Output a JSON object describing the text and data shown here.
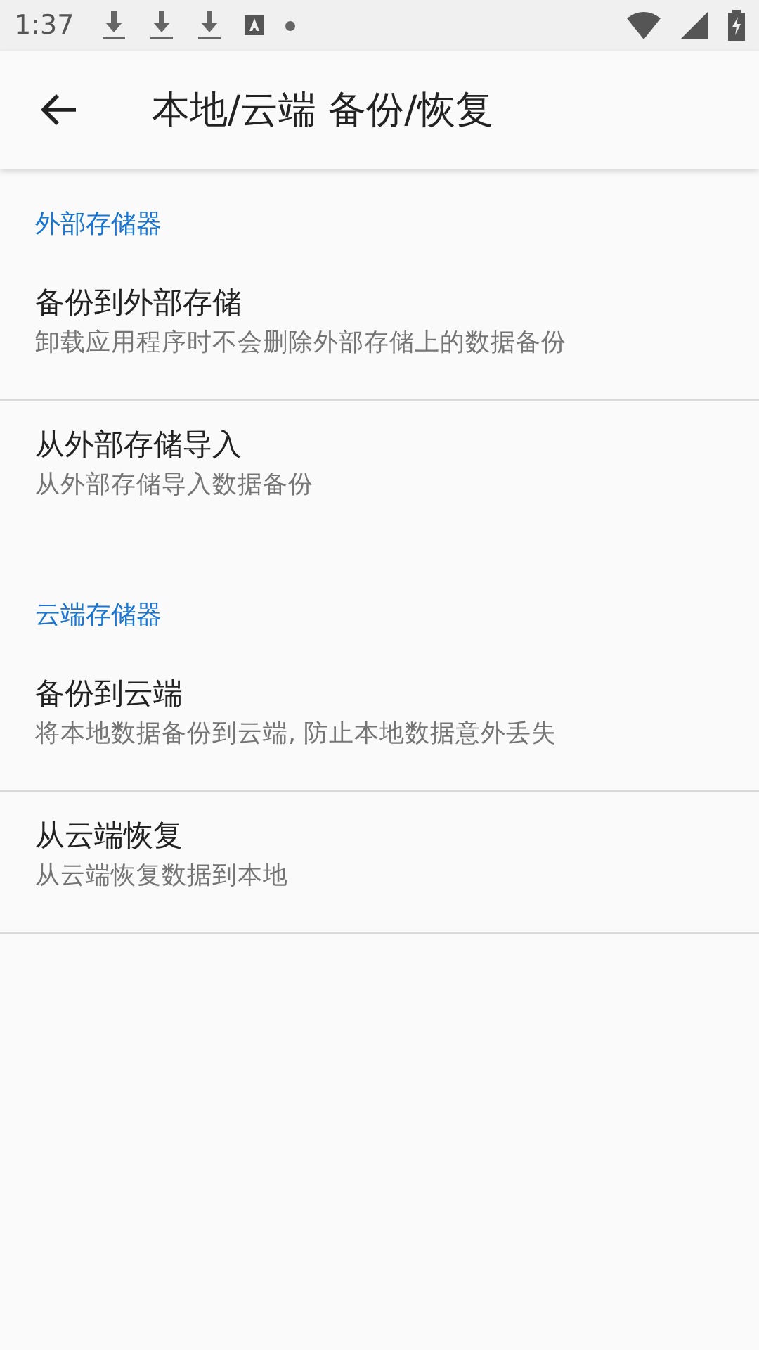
{
  "status_bar": {
    "time": "1:37"
  },
  "app_bar": {
    "title": "本地/云端 备份/恢复"
  },
  "sections": [
    {
      "header": "外部存储器",
      "items": [
        {
          "title": "备份到外部存储",
          "summary": "卸载应用程序时不会删除外部存储上的数据备份"
        },
        {
          "title": "从外部存储导入",
          "summary": "从外部存储导入数据备份"
        }
      ]
    },
    {
      "header": "云端存储器",
      "items": [
        {
          "title": "备份到云端",
          "summary": "将本地数据备份到云端, 防止本地数据意外丢失"
        },
        {
          "title": "从云端恢复",
          "summary": "从云端恢复数据到本地"
        }
      ]
    }
  ]
}
